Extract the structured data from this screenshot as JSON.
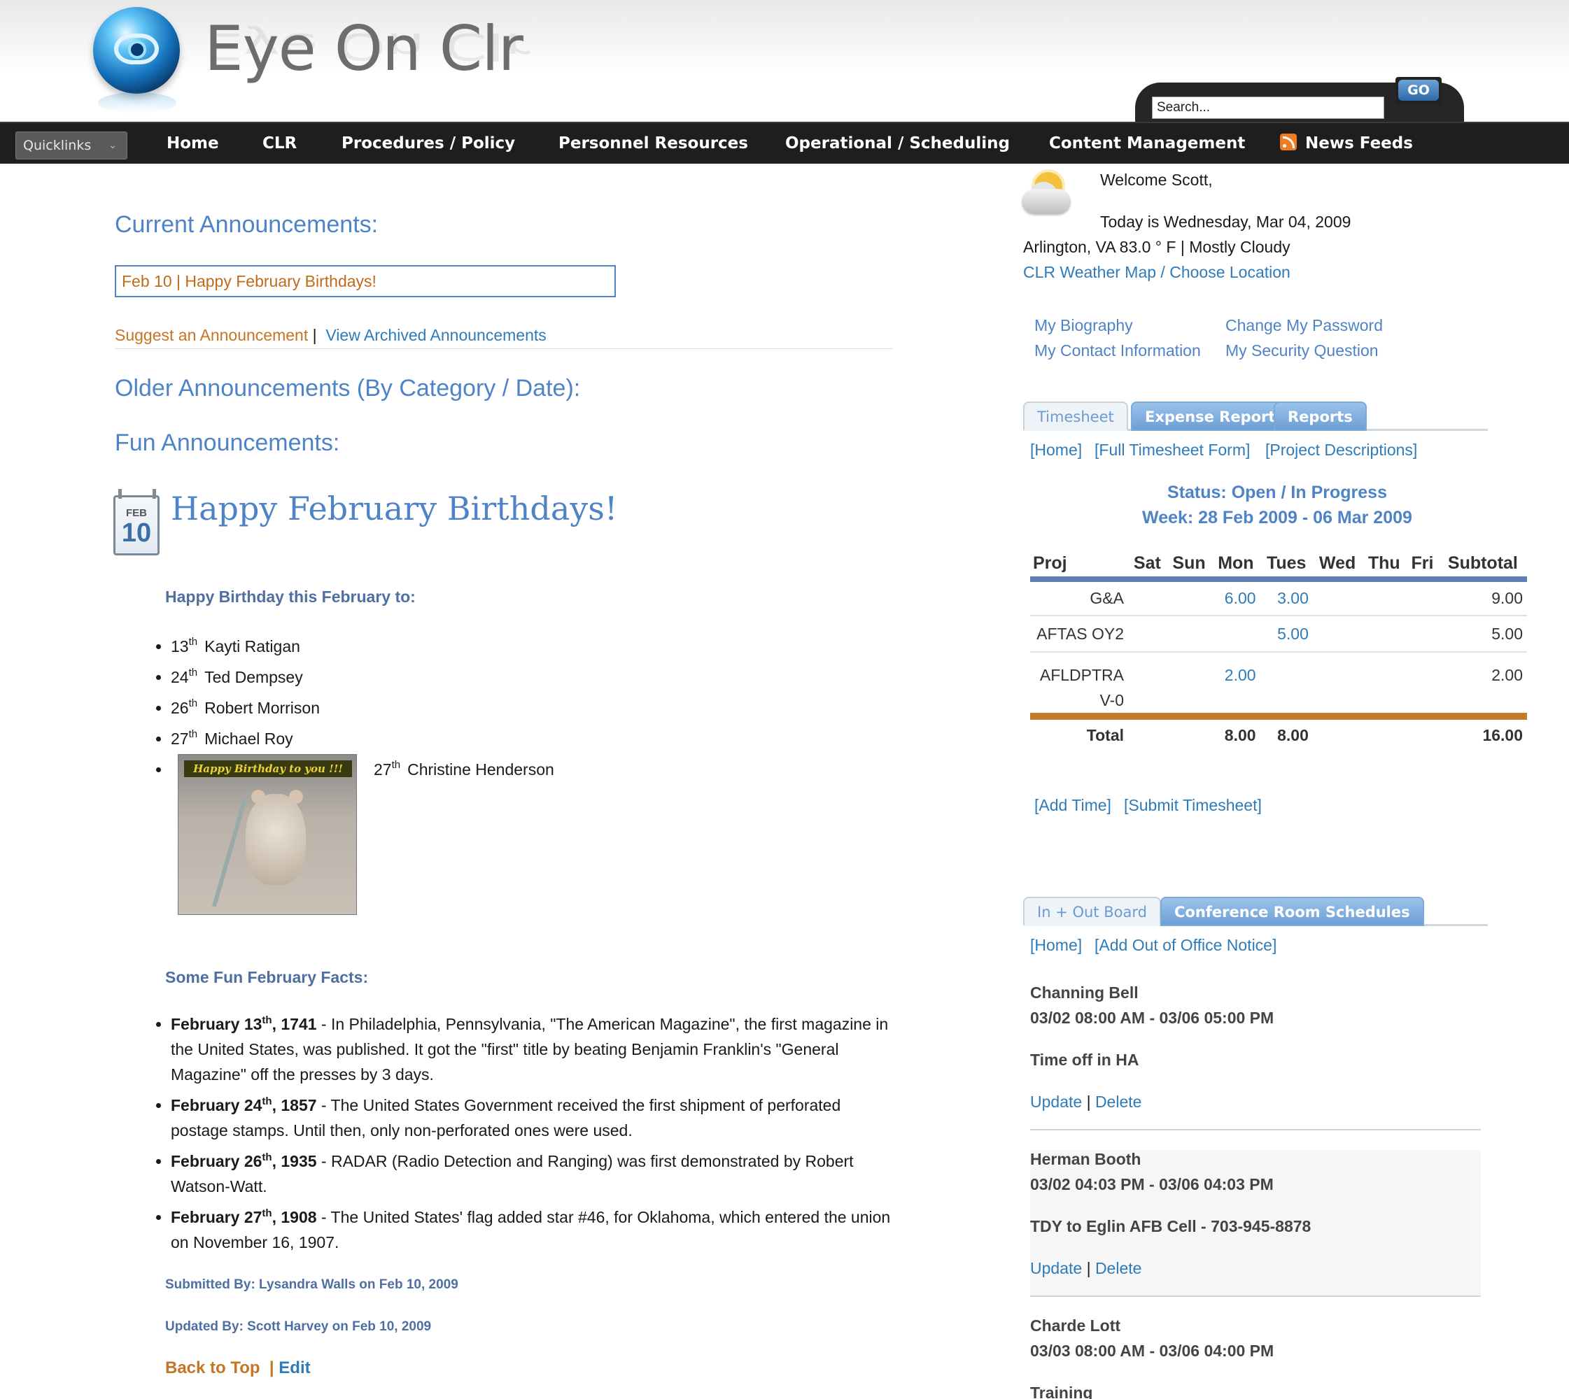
{
  "header": {
    "logo_text": "Eye On Clr",
    "search_placeholder": "Search...",
    "go_label": "GO"
  },
  "nav": {
    "quicklinks": "Quicklinks",
    "items": [
      "Home",
      "CLR",
      "Procedures / Policy",
      "Personnel Resources",
      "Operational / Scheduling",
      "Content Management",
      "News Feeds"
    ]
  },
  "main": {
    "current_heading": "Current Announcements:",
    "current_item": "Feb 10 | Happy February Birthdays!",
    "suggest_link": "Suggest an Announcement",
    "link_sep": "|",
    "archived_link": "View Archived Announcements",
    "older_heading": "Older Announcements (By Category / Date):",
    "fun_heading": "Fun Announcements:",
    "calendar_month": "FEB",
    "calendar_day": "10",
    "post_title": "Happy February Birthdays!",
    "birthday_intro": "Happy Birthday this February to:",
    "birthdays": [
      {
        "day": "13",
        "suffix": "th",
        "name": "Kayti Ratigan"
      },
      {
        "day": "24",
        "suffix": "th",
        "name": "Ted Dempsey"
      },
      {
        "day": "26",
        "suffix": "th",
        "name": "Robert Morrison"
      },
      {
        "day": "27",
        "suffix": "th",
        "name": "Michael Roy"
      },
      {
        "day": "27",
        "suffix": "th",
        "name": "Christine Henderson"
      }
    ],
    "hamster_banner": "Happy Birthday to you !!!",
    "facts_intro": "Some Fun February Facts:",
    "facts": [
      {
        "date_a": "February 13",
        "sup": "th",
        "date_b": ", 1741",
        "text": " - In Philadelphia, Pennsylvania, \"The American Magazine\", the first magazine in the United States, was published. It got the \"first\" title by beating Benjamin Franklin's \"General Magazine\" off the presses by 3 days."
      },
      {
        "date_a": "February 24",
        "sup": "th",
        "date_b": ", 1857",
        "text": " - The United States Government received the first shipment of perforated postage stamps. Until then, only non-perforated ones were used."
      },
      {
        "date_a": "February 26",
        "sup": "th",
        "date_b": ", 1935",
        "text": " - RADAR (Radio Detection and Ranging) was first demonstrated by Robert Watson-Watt."
      },
      {
        "date_a": "February 27",
        "sup": "th",
        "date_b": ", 1908",
        "text": " - The United States' flag added star #46, for Oklahoma, which entered the union on November 16, 1907."
      }
    ],
    "submitted_by": "Submitted By: Lysandra Walls on Feb 10, 2009",
    "updated_by": "Updated By: Scott Harvey on Feb 10, 2009",
    "back_to_top": "Back to Top",
    "edit_sep": "|",
    "edit": "Edit"
  },
  "sidebar": {
    "welcome": "Welcome Scott,",
    "today": "Today is Wednesday, Mar 04, 2009",
    "weather": "Arlington, VA  83.0 ° F | Mostly Cloudy",
    "weather_link": "CLR Weather Map / Choose Location",
    "profile_links": [
      "My Biography",
      "Change My Password",
      "My Contact Information",
      "My Security Question"
    ],
    "ts_tabs": [
      "Timesheet",
      "Expense Report",
      "Reports"
    ],
    "ts_links": [
      "[Home]",
      "[Full Timesheet Form]",
      "[Project Descriptions]"
    ],
    "status": "Status: Open / In Progress",
    "week": "Week: 28 Feb 2009 - 06 Mar 2009",
    "table": {
      "headers": [
        "Proj",
        "Sat",
        "Sun",
        "Mon",
        "Tues",
        "Wed",
        "Thu",
        "Fri",
        "Subtotal"
      ],
      "rows": [
        {
          "proj": "G&A",
          "mon": "6.00",
          "tues": "3.00",
          "subtotal": "9.00"
        },
        {
          "proj": "AFTAS OY2",
          "mon": "",
          "tues": "5.00",
          "subtotal": "5.00"
        },
        {
          "proj": "AFLDPTRAV-0",
          "mon": "2.00",
          "tues": "",
          "subtotal": "2.00"
        }
      ],
      "total": {
        "label": "Total",
        "mon": "8.00",
        "tues": "8.00",
        "subtotal": "16.00"
      }
    },
    "ts_actions": [
      "[Add Time]",
      "[Submit Timesheet]"
    ],
    "board_tabs": [
      "In + Out Board",
      "Conference Room Schedules"
    ],
    "board_links": [
      "[Home]",
      "[Add Out of Office Notice]"
    ],
    "board_entries": [
      {
        "name": "Channing Bell",
        "range": "03/02 08:00 AM - 03/06 05:00 PM",
        "reason": "Time off in HA",
        "update": "Update",
        "sep": "|",
        "delete": "Delete"
      },
      {
        "name": "Herman Booth",
        "range": "03/02 04:03 PM - 03/06 04:03 PM",
        "reason": "TDY to Eglin AFB Cell - 703-945-8878",
        "update": "Update",
        "sep": "|",
        "delete": "Delete"
      },
      {
        "name": "Charde Lott",
        "range": "03/03 08:00 AM - 03/06 04:00 PM",
        "reason": "Training"
      }
    ]
  }
}
